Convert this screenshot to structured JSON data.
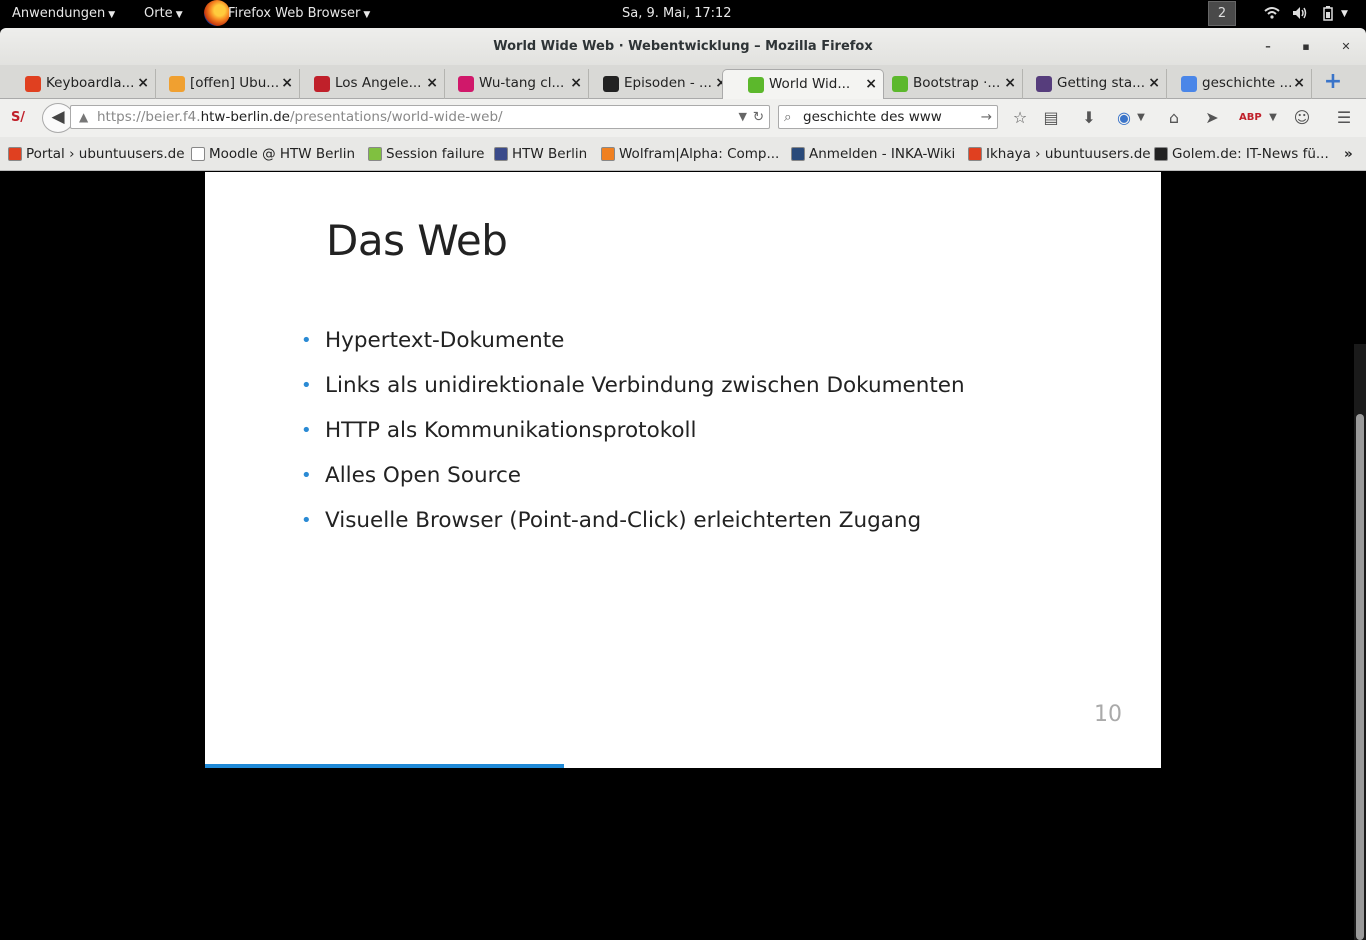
{
  "topbar": {
    "applications": "Anwendungen",
    "places": "Orte",
    "app_name": "Firefox Web Browser",
    "clock": "Sa,  9. Mai, 17:12",
    "workspace": "2"
  },
  "window": {
    "title": "World Wide Web · Webentwicklung – Mozilla Firefox",
    "minimize": "–",
    "maximize": "▪",
    "close": "✕"
  },
  "tabs": [
    {
      "label": "Keyboardla...",
      "icon_color": "#e04020"
    },
    {
      "label": "[offen] Ubu...",
      "icon_color": "#f0a030"
    },
    {
      "label": "Los Angele...",
      "icon_color": "#c0202a"
    },
    {
      "label": "Wu-tang cl...",
      "icon_color": "#d0186a"
    },
    {
      "label": "Episoden - ...",
      "icon_color": "#222222"
    },
    {
      "label": "World Wid...",
      "icon_color": "#5cb82c",
      "active": true
    },
    {
      "label": "Bootstrap ·...",
      "icon_color": "#5cb82c"
    },
    {
      "label": "Getting sta...",
      "icon_color": "#563d7c"
    },
    {
      "label": "geschichte ...",
      "icon_color": "#4a86e8"
    }
  ],
  "navbar": {
    "url_prefix": "https://beier.f4.",
    "url_host": "htw-berlin.de",
    "url_path": "/presentations/world-wide-web/",
    "search_value": "geschichte des www"
  },
  "bookmarks": [
    {
      "label": "Portal › ubuntuusers.de",
      "icon_color": "#e04020"
    },
    {
      "label": "Moodle @ HTW Berlin",
      "icon_color": "#ffffff"
    },
    {
      "label": "Session failure",
      "icon_color": "#80c040"
    },
    {
      "label": "HTW Berlin",
      "icon_color": "#3a4a8a"
    },
    {
      "label": "Wolfram|Alpha: Comp...",
      "icon_color": "#f08020"
    },
    {
      "label": "Anmelden - INKA-Wiki",
      "icon_color": "#2a4a7a"
    },
    {
      "label": "Ikhaya › ubuntuusers.de",
      "icon_color": "#e04020"
    },
    {
      "label": "Golem.de: IT-News fü...",
      "icon_color": "#222222"
    }
  ],
  "bookmarks_more": "»",
  "slide": {
    "title": "Das Web",
    "bullets": [
      "Hypertext-Dokumente",
      "Links als unidirektionale Verbindung zwischen Dokumenten",
      "HTTP als Kommunikationsprotokoll",
      "Alles Open Source",
      "Visuelle Browser (Point-and-Click) erleichterten Zugang"
    ],
    "page_number": "10",
    "progress_fraction": 0.375
  },
  "colors": {
    "accent": "#1f8ad8",
    "new_tab": "#3a74c9"
  }
}
